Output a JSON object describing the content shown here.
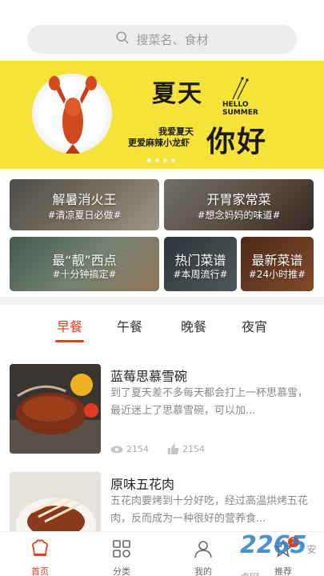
{
  "search": {
    "placeholder": "搜菜名、食材"
  },
  "banner": {
    "title": "夏天",
    "hello": "HELLO",
    "summer": "SUMMER",
    "big": "你好",
    "line1": "我爱夏天",
    "line2": "更爱麻辣小龙虾"
  },
  "categories": [
    {
      "title": "解暑消火王",
      "tag": "#清凉夏日必做#"
    },
    {
      "title": "开胃家常菜",
      "tag": "#想念妈妈的味道#"
    },
    {
      "title": "最“靓”西点",
      "tag": "#十分钟搞定#"
    },
    {
      "title": "热门菜谱",
      "tag": "#本周流行#"
    },
    {
      "title": "最新菜谱",
      "tag": "#24小时推#"
    }
  ],
  "tabs": [
    "早餐",
    "午餐",
    "晚餐",
    "夜宵"
  ],
  "recipes": [
    {
      "title": "蓝莓思慕雪碗",
      "desc": "到了夏天差不多每天都会打上一杯思慕雪，最近迷上了思慕雪碗，可以加...",
      "views": "2154",
      "likes": "2154"
    },
    {
      "title": "原味五花肉",
      "desc": "五花肉要烤到十分好吃，经过高温烘烤五花肉，反而成为一种很好的营养食..."
    }
  ],
  "nav": [
    {
      "label": "首页",
      "icon": "chef-hat-icon"
    },
    {
      "label": "分类",
      "icon": "grid-icon"
    },
    {
      "label": "我的",
      "icon": "user-icon"
    },
    {
      "label": "推荐",
      "icon": "star-icon",
      "badge": "1"
    }
  ],
  "watermark": {
    "brand": "2265",
    "sub": "安卓网"
  },
  "colors": {
    "accent": "#e8401c",
    "banner": "#f5e33a"
  }
}
